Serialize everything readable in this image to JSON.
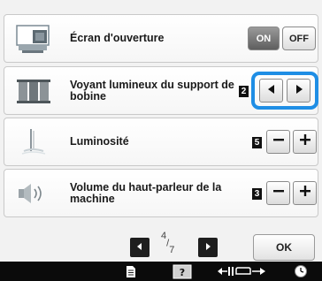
{
  "rows": [
    {
      "label": "Écran d'ouverture",
      "on_label": "ON",
      "off_label": "OFF",
      "selected": "ON"
    },
    {
      "label": "Voyant lumineux du support de bobine",
      "value": "2"
    },
    {
      "label": "Luminosité",
      "value": "5"
    },
    {
      "label": "Volume du haut-parleur de la machine",
      "value": "3"
    }
  ],
  "navigation": {
    "page_current": "4",
    "page_total": "7",
    "ok_label": "OK"
  },
  "icons": {
    "row_icons": [
      "opening-screen-icon",
      "spool-light-icon",
      "needle-light-icon",
      "speaker-icon"
    ],
    "bottom_bar": [
      "document-icon",
      "help-icon",
      "horizontal-adjust-icon",
      "clock-icon"
    ]
  },
  "colors": {
    "highlight": "#1f8ee5",
    "toggle_on": "#5e5e5e",
    "bottom_bar": "#0b0b0b"
  }
}
